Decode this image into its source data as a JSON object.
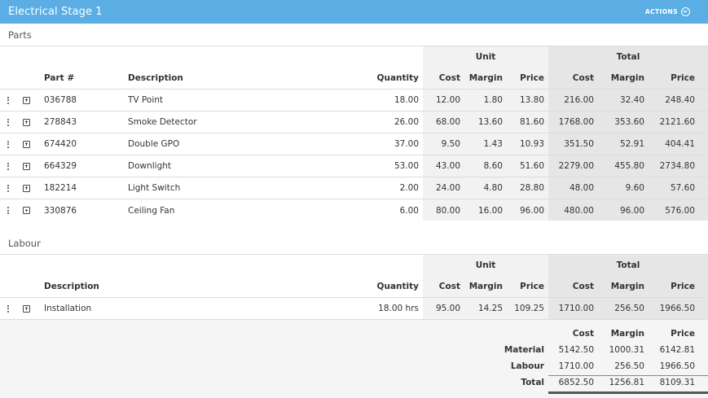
{
  "header": {
    "title": "Electrical Stage 1",
    "actions_label": "ACTIONS"
  },
  "parts": {
    "section_title": "Parts",
    "group_unit": "Unit",
    "group_total": "Total",
    "columns": {
      "part": "Part #",
      "description": "Description",
      "quantity": "Quantity",
      "unit_cost": "Cost",
      "unit_margin": "Margin",
      "unit_price": "Price",
      "total_cost": "Cost",
      "total_margin": "Margin",
      "total_price": "Price"
    },
    "rows": [
      {
        "part": "036788",
        "description": "TV Point",
        "quantity": "18.00",
        "unit_cost": "12.00",
        "unit_margin": "1.80",
        "unit_price": "13.80",
        "total_cost": "216.00",
        "total_margin": "32.40",
        "total_price": "248.40"
      },
      {
        "part": "278843",
        "description": "Smoke Detector",
        "quantity": "26.00",
        "unit_cost": "68.00",
        "unit_margin": "13.60",
        "unit_price": "81.60",
        "total_cost": "1768.00",
        "total_margin": "353.60",
        "total_price": "2121.60"
      },
      {
        "part": "674420",
        "description": "Double GPO",
        "quantity": "37.00",
        "unit_cost": "9.50",
        "unit_margin": "1.43",
        "unit_price": "10.93",
        "total_cost": "351.50",
        "total_margin": "52.91",
        "total_price": "404.41"
      },
      {
        "part": "664329",
        "description": "Downlight",
        "quantity": "53.00",
        "unit_cost": "43.00",
        "unit_margin": "8.60",
        "unit_price": "51.60",
        "total_cost": "2279.00",
        "total_margin": "455.80",
        "total_price": "2734.80"
      },
      {
        "part": "182214",
        "description": "Light Switch",
        "quantity": "2.00",
        "unit_cost": "24.00",
        "unit_margin": "4.80",
        "unit_price": "28.80",
        "total_cost": "48.00",
        "total_margin": "9.60",
        "total_price": "57.60"
      },
      {
        "part": "330876",
        "description": "Ceiling Fan",
        "quantity": "6.00",
        "unit_cost": "80.00",
        "unit_margin": "16.00",
        "unit_price": "96.00",
        "total_cost": "480.00",
        "total_margin": "96.00",
        "total_price": "576.00"
      }
    ]
  },
  "labour": {
    "section_title": "Labour",
    "group_unit": "Unit",
    "group_total": "Total",
    "columns": {
      "description": "Description",
      "quantity": "Quantity",
      "unit_cost": "Cost",
      "unit_margin": "Margin",
      "unit_price": "Price",
      "total_cost": "Cost",
      "total_margin": "Margin",
      "total_price": "Price"
    },
    "rows": [
      {
        "description": "Installation",
        "quantity": "18.00 hrs",
        "unit_cost": "95.00",
        "unit_margin": "14.25",
        "unit_price": "109.25",
        "total_cost": "1710.00",
        "total_margin": "256.50",
        "total_price": "1966.50"
      }
    ]
  },
  "summary": {
    "columns": {
      "cost": "Cost",
      "margin": "Margin",
      "price": "Price"
    },
    "rows": [
      {
        "label": "Material",
        "cost": "5142.50",
        "margin": "1000.31",
        "price": "6142.81"
      },
      {
        "label": "Labour",
        "cost": "1710.00",
        "margin": "256.50",
        "price": "1966.50"
      },
      {
        "label": "Total",
        "cost": "6852.50",
        "margin": "1256.81",
        "price": "8109.31"
      }
    ]
  }
}
